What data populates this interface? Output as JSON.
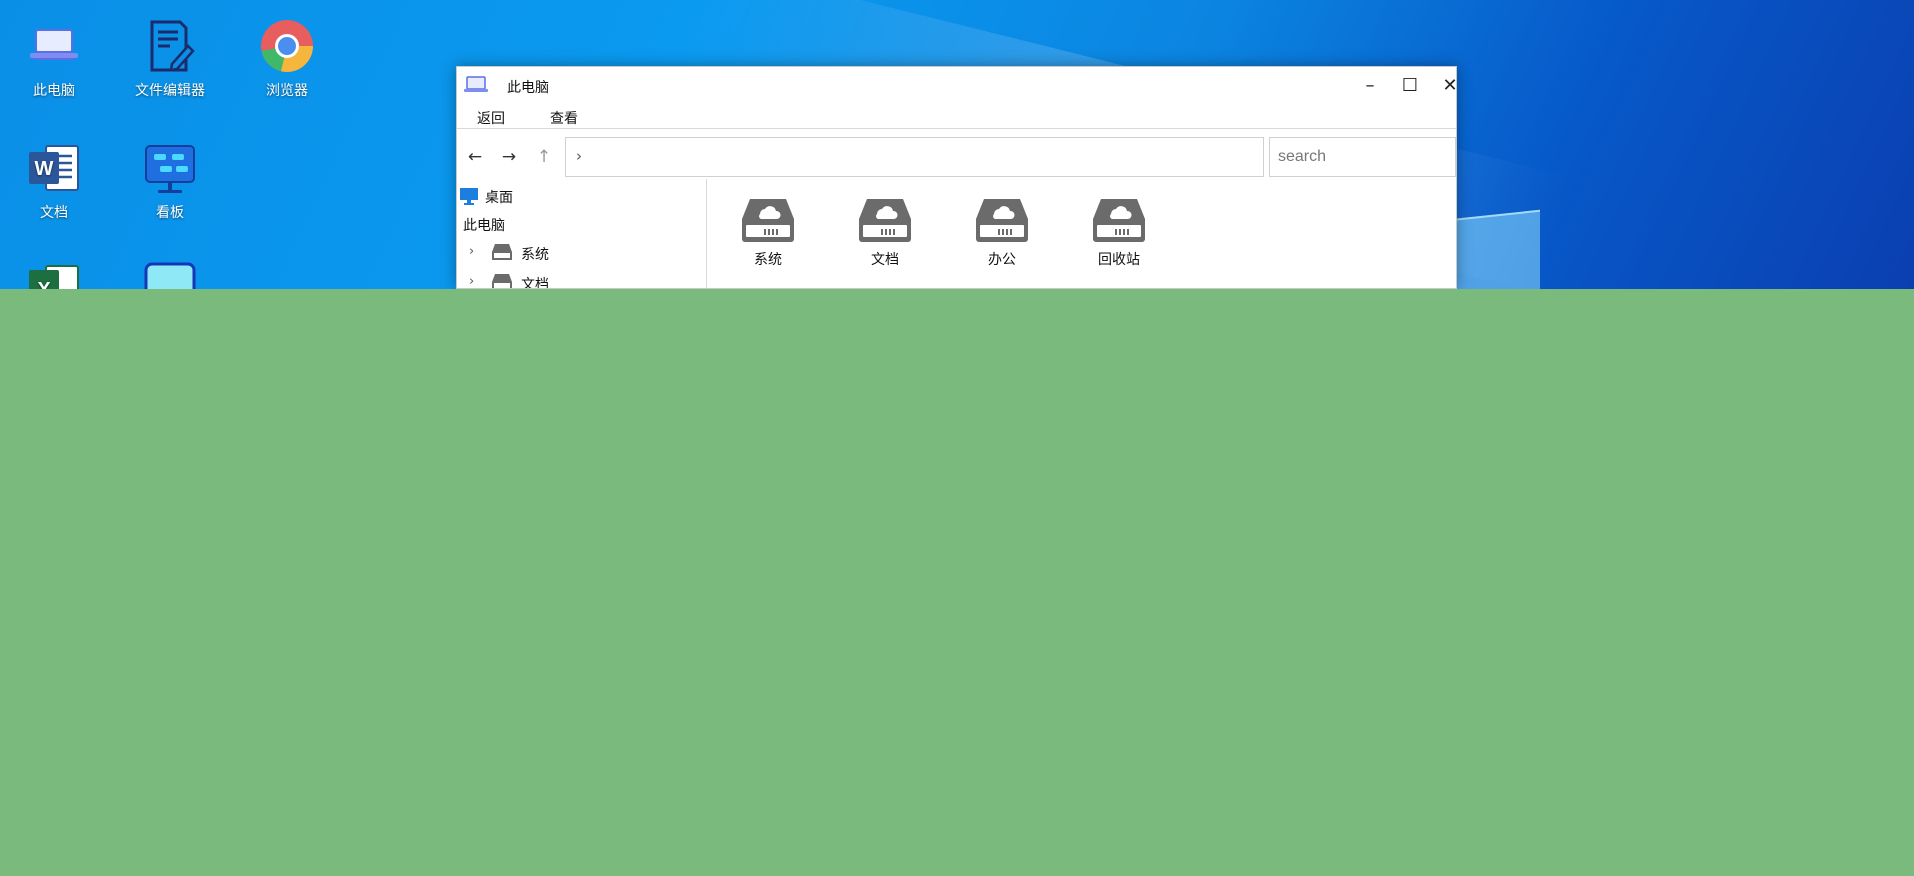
{
  "desktop": {
    "icons": [
      {
        "label": "此电脑",
        "icon": "laptop-icon"
      },
      {
        "label": "文件编辑器",
        "icon": "document-edit-icon"
      },
      {
        "label": "浏览器",
        "icon": "chrome-icon"
      },
      {
        "label": "文档",
        "icon": "word-icon"
      },
      {
        "label": "看板",
        "icon": "kanban-icon"
      },
      {
        "label": "",
        "icon": "excel-icon"
      },
      {
        "label": "",
        "icon": "chat-icon"
      }
    ]
  },
  "window": {
    "title": "此电脑",
    "title_icon": "laptop-icon",
    "controls": {
      "minimize": "–",
      "maximize": "☐",
      "close": "✕"
    },
    "menu": {
      "back": "返回",
      "view": "查看"
    },
    "nav": {
      "back": "←",
      "forward": "→",
      "up": "↑",
      "address_chevron": "›"
    },
    "search": {
      "placeholder": "search",
      "value": ""
    },
    "sidebar": {
      "desktop": "桌面",
      "this_pc": "此电脑",
      "items": [
        {
          "label": "系统",
          "chevron": "›"
        },
        {
          "label": "文档",
          "chevron": "›"
        }
      ]
    },
    "drives": [
      {
        "label": "系统"
      },
      {
        "label": "文档"
      },
      {
        "label": "办公"
      },
      {
        "label": "回收站"
      }
    ]
  },
  "colors": {
    "desktop_blue": "#0a8fe6",
    "overlay_green": "#7aba7d",
    "drive_gray": "#6b6b6b"
  }
}
